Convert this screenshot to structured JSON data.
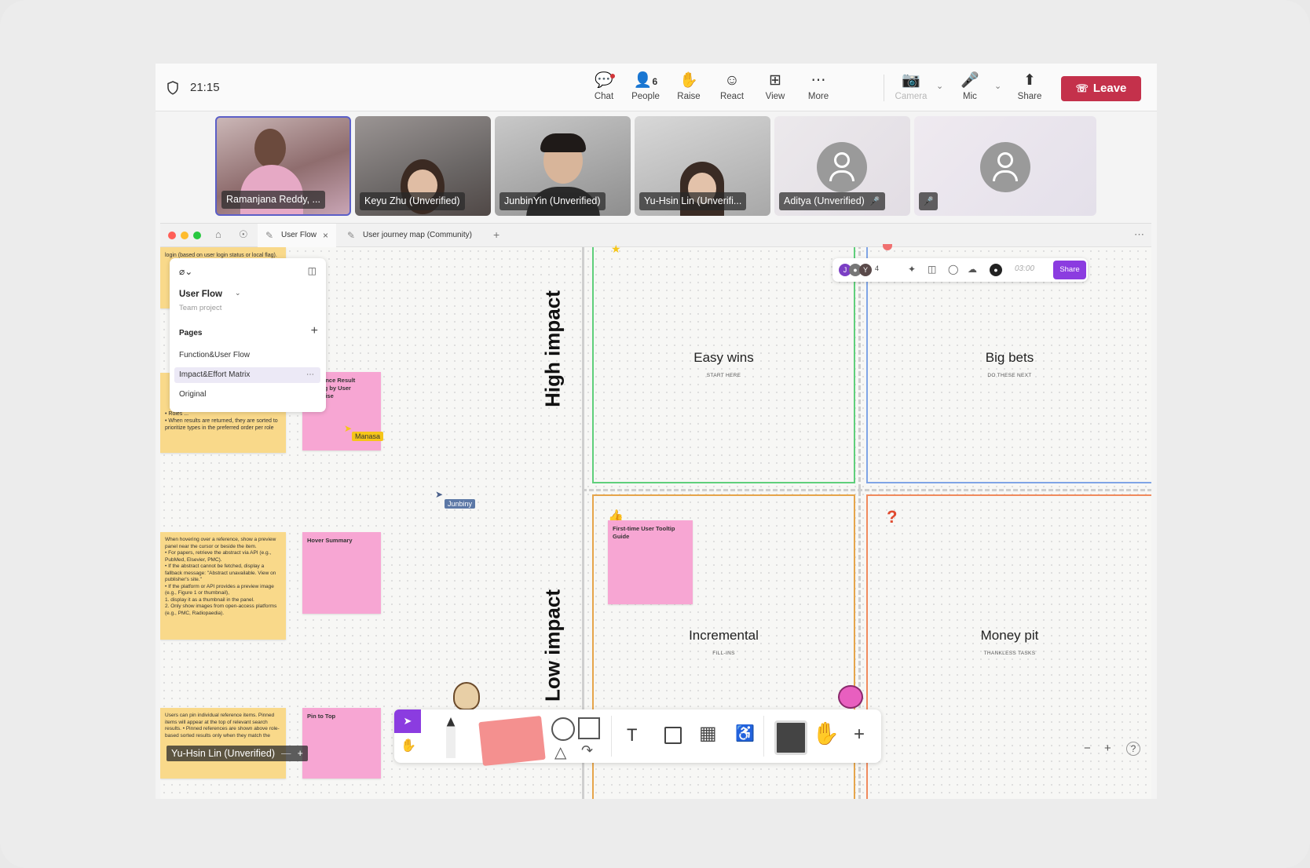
{
  "meeting": {
    "time": "21:15",
    "chat_label": "Chat",
    "people_count": "6",
    "people_label": "People",
    "raise_label": "Raise",
    "react_label": "React",
    "view_label": "View",
    "more_label": "More",
    "camera_label": "Camera",
    "mic_label": "Mic",
    "share_label": "Share",
    "leave_label": "Leave"
  },
  "participants": [
    {
      "name": "Ramanjana Reddy, ..."
    },
    {
      "name": "Keyu Zhu (Unverified)"
    },
    {
      "name": "JunbinYin (Unverified)"
    },
    {
      "name": "Yu-Hsin Lin (Unverifi..."
    },
    {
      "name": "Aditya (Unverified)"
    },
    {
      "name": ""
    }
  ],
  "figjam": {
    "tabs": [
      {
        "label": "User Flow"
      },
      {
        "label": "User journey map (Community)"
      }
    ],
    "file_name": "User Flow",
    "file_sub": "Team project",
    "pages_label": "Pages",
    "pages": [
      "Function&User Flow",
      "Impact&Effort Matrix",
      "Original"
    ],
    "collab_count": "4",
    "timer": "03:00",
    "share_label": "Share",
    "axis_high": "High impact",
    "axis_low": "Low impact",
    "quadrants": [
      {
        "title": "Easy wins",
        "sub": "START HERE"
      },
      {
        "title": "Big bets",
        "sub": "DO THESE NEXT"
      },
      {
        "title": "Incremental",
        "sub": "FILL-INS"
      },
      {
        "title": "Money pit",
        "sub": "THANKLESS TASKS"
      }
    ],
    "stickies": {
      "y1_top": "login (based on user login status or local flag).",
      "y2_lines": "• Roles ...\n• When results are returned, they are sorted to prioritize types in the preferred order per role",
      "pink1_title": "Reference Result Sorting by User Expertise",
      "y3_text": "When hovering over a reference, show a preview panel near the cursor or beside the item.\n• For papers, retrieve the abstract via API (e.g., PubMed, Elsevier, PMC).\n• If the abstract cannot be fetched, display a fallback message: \"Abstract unavailable. View on publisher's site.\"\n• If the platform or API provides a preview image (e.g., Figure 1 or thumbnail),\n1. display it as a thumbnail in the panel.\n2. Only show images from open-access platforms (e.g., PMC, Radiopaedia).",
      "pink2_title": "Hover Summary",
      "y4_text": "Users can pin individual reference items. Pinned items will appear at the top of relevant search results.\n• Pinned references are shown above role-based sorted results only when they match the",
      "pink3_title": "Pin to Top",
      "pink4_title": "First-time User Tooltip Guide"
    },
    "cursors": {
      "manasa": "Manasa",
      "junbin": "Junbiny"
    },
    "name_overlay": "Yu-Hsin Lin (Unverified)"
  }
}
